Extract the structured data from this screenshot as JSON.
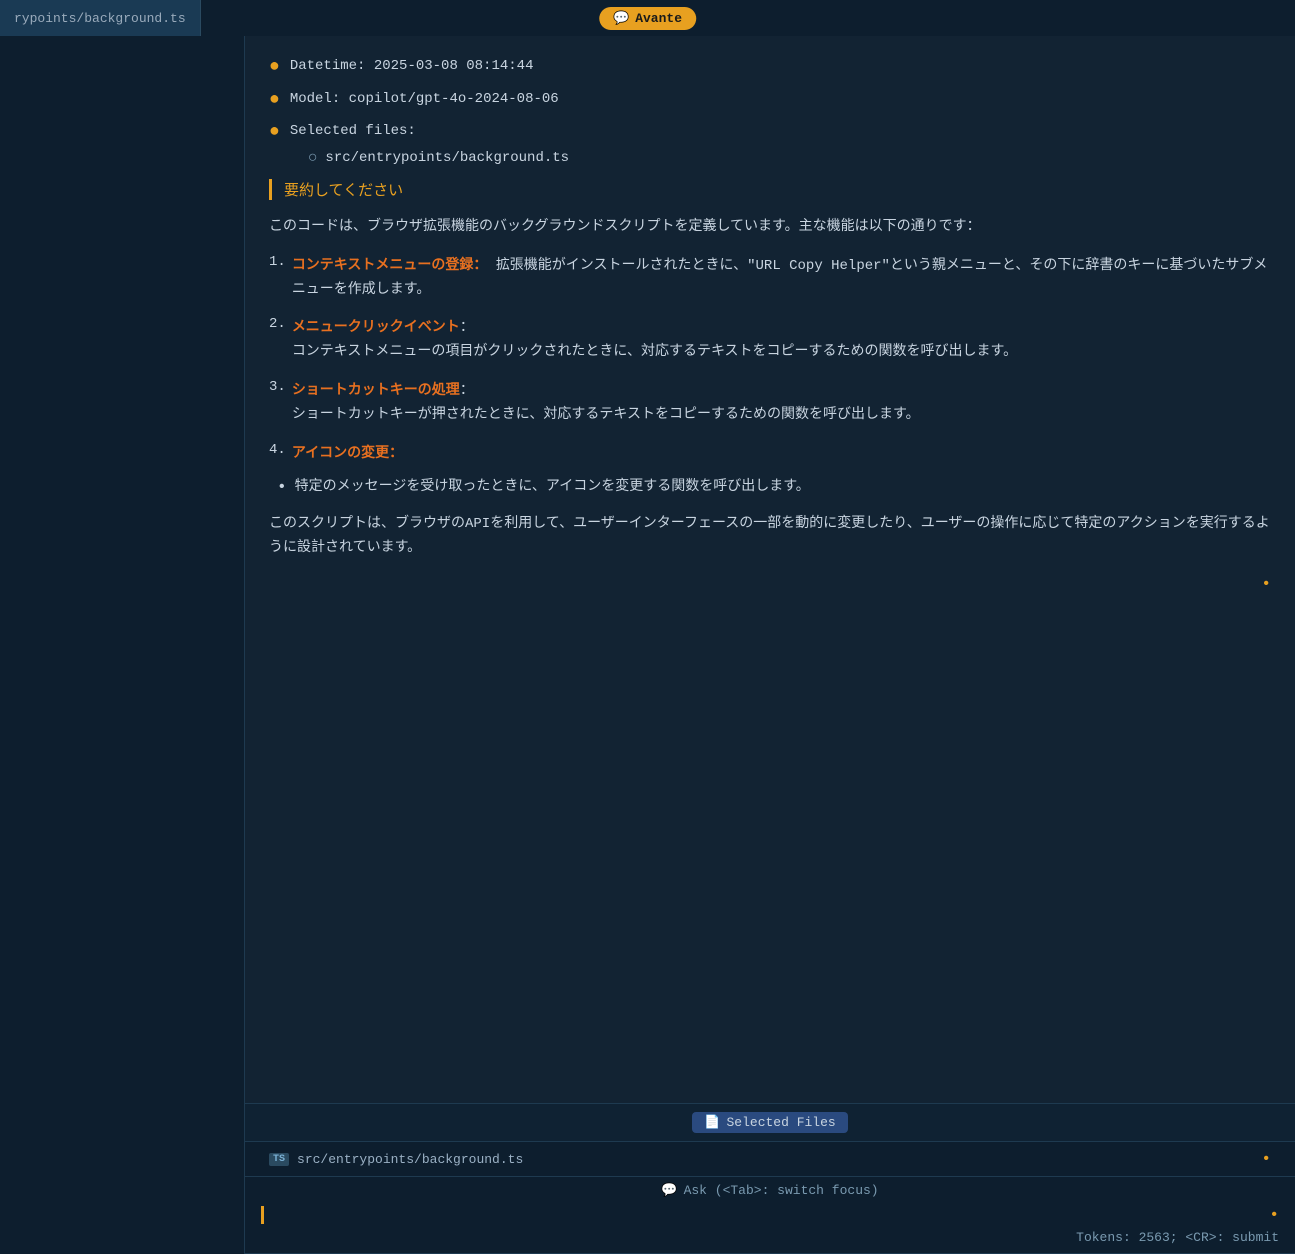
{
  "top_bar": {
    "file_tab_label": "rypoints/background.ts",
    "avante_icon": "💬",
    "avante_label": "Avante"
  },
  "metadata": {
    "datetime_label": "Datetime:",
    "datetime_value": "2025-03-08 08:14:44",
    "model_label": "Model:",
    "model_value": "copilot/gpt-4o-2024-08-06",
    "selected_files_label": "Selected files:",
    "selected_file_path": "src/entrypoints/background.ts"
  },
  "user_question": "要約してください",
  "response": {
    "intro": "このコードは、ブラウザ拡張機能のバックグラウンドスクリプトを定義しています。主な機能は以下の通りです：",
    "items": [
      {
        "number": "1.",
        "title": "コンテキストメニューの登録",
        "colon": ":",
        "desc": "拡張機能がインストールされたときに、\"URL Copy Helper\"という親メニューと、その下に辞書のキーに基づいたサブメニューを作成します。"
      },
      {
        "number": "2.",
        "title": "メニュークリックイベント",
        "colon": ":",
        "desc": "コンテキストメニューの項目がクリックされたときに、対応するテキストをコピーするための関数を呼び出します。"
      },
      {
        "number": "3.",
        "title": "ショートカットキーの処理",
        "colon": ":",
        "desc": "ショートカットキーが押されたときに、対応するテキストをコピーするための関数を呼び出します。"
      },
      {
        "number": "4.",
        "title": "アイコンの変更",
        "colon": ":",
        "bullet_desc": "特定のメッセージを受け取ったときに、アイコンを変更する関数を呼び出します。"
      }
    ],
    "closing": "このスクリプトは、ブラウザのAPIを利用して、ユーザーインターフェースの一部を動的に変更したり、ユーザーの操作に応じて特定のアクションを実行するように設計されています。"
  },
  "bottom": {
    "selected_files_btn_icon": "📄",
    "selected_files_btn_label": "Selected Files",
    "file_ext": "TS",
    "file_path": "src/entrypoints/background.ts",
    "input_hint_icon": "💬",
    "input_hint_text": "Ask (<Tab>: switch focus)",
    "token_info": "Tokens: 2563; <CR>: submit"
  }
}
